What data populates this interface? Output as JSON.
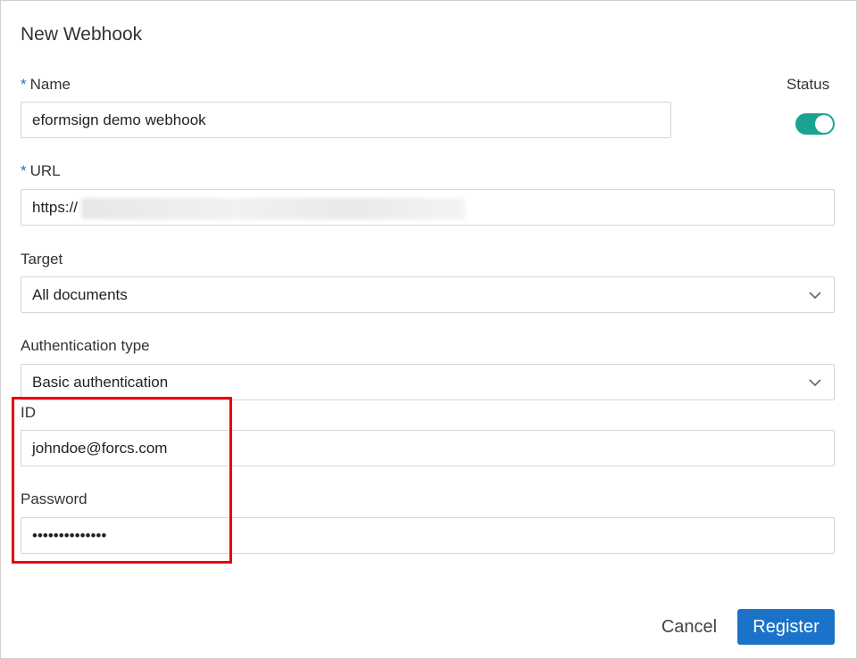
{
  "dialog": {
    "title": "New Webhook"
  },
  "fields": {
    "name": {
      "required_mark": "*",
      "label": "Name",
      "value": "eformsign demo webhook"
    },
    "status": {
      "label": "Status",
      "enabled": true
    },
    "url": {
      "required_mark": "*",
      "label": "URL",
      "value_prefix": "https://"
    },
    "target": {
      "label": "Target",
      "selected": "All documents"
    },
    "auth_type": {
      "label": "Authentication type",
      "selected": "Basic authentication"
    },
    "id": {
      "label": "ID",
      "value": "johndoe@forcs.com"
    },
    "password": {
      "label": "Password",
      "value": "••••••••••••••"
    }
  },
  "buttons": {
    "cancel": "Cancel",
    "register": "Register"
  },
  "colors": {
    "accent": "#1a73c9",
    "toggle_on": "#1aa394",
    "highlight": "#e8000b"
  }
}
